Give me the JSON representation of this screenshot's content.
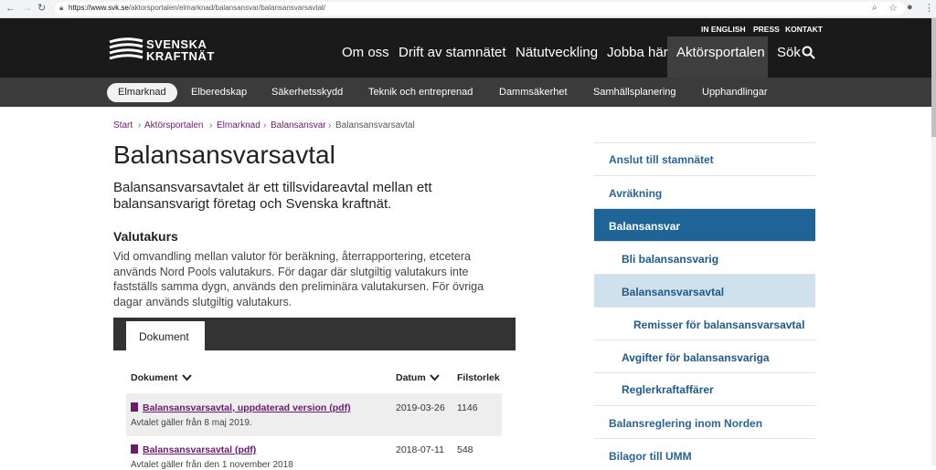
{
  "browser": {
    "url_host": "https://www.svk.se",
    "url_path": "/aktorsportalen/elmarknad/balansansvar/balansansvarsavtal/"
  },
  "header": {
    "logo_line1": "SVENSKA",
    "logo_line2": "KRAFTNÄT",
    "util_links": [
      "IN ENGLISH",
      "PRESS",
      "KONTAKT"
    ],
    "main_nav": [
      "Om oss",
      "Drift av stamnätet",
      "Nätutveckling",
      "Jobba här",
      "Aktörsportalen",
      "Sök"
    ]
  },
  "subnav": [
    "Elmarknad",
    "Elberedskap",
    "Säkerhetsskydd",
    "Teknik och entreprenad",
    "Dammsäkerhet",
    "Samhällsplanering",
    "Upphandlingar"
  ],
  "breadcrumb": [
    "Start",
    "Aktörsportalen",
    "Elmarknad",
    "Balansansvar",
    "Balansansvarsavtal"
  ],
  "page": {
    "title": "Balansansvarsavtal",
    "lead": "Balansansvarsavtalet är ett tillsvidareavtal mellan ett balansansvarigt företag och Svenska kraftnät.",
    "section_title": "Valutakurs",
    "section_body": "Vid omvandling mellan valutor för beräkning, återrapportering, etcetera används Nord Pools valutakurs. För dagar där slutgiltig valutakurs inte fastställs samma dygn, används den preliminära valutakursen. För övriga dagar används slutgiltig valutakurs."
  },
  "documents": {
    "tab_label": "Dokument",
    "headers": [
      "Dokument",
      "Datum",
      "Filstorlek"
    ],
    "rows": [
      {
        "title": "Balansansvarsavtal, uppdaterad version (pdf)",
        "note": "Avtalet gäller från 8 maj 2019.",
        "date": "2019-03-26",
        "size": "1146"
      },
      {
        "title": "Balansansvarsavtal (pdf)",
        "note": "Avtalet gäller från den 1 november 2018",
        "date": "2018-07-11",
        "size": "548"
      }
    ]
  },
  "sidebar": [
    {
      "label": "Anslut till stamnätet",
      "level": 0
    },
    {
      "label": "Avräkning",
      "level": 0
    },
    {
      "label": "Balansansvar",
      "level": 0,
      "state": "active"
    },
    {
      "label": "Bli balansansvarig",
      "level": 1
    },
    {
      "label": "Balansansvarsavtal",
      "level": 1,
      "state": "current"
    },
    {
      "label": "Remisser för balansansvarsavtal",
      "level": 2
    },
    {
      "label": "Avgifter för balansansvariga",
      "level": 1
    },
    {
      "label": "Reglerkraftaffärer",
      "level": 1
    },
    {
      "label": "Balansreglering inom Norden",
      "level": 0
    },
    {
      "label": "Bilagor till UMM",
      "level": 0
    }
  ],
  "colors": {
    "header_bg": "#1a1a1a",
    "subnav_bg": "#3b3b3b",
    "accent_blue": "#1f6496",
    "link_purple": "#6b1a6e"
  }
}
